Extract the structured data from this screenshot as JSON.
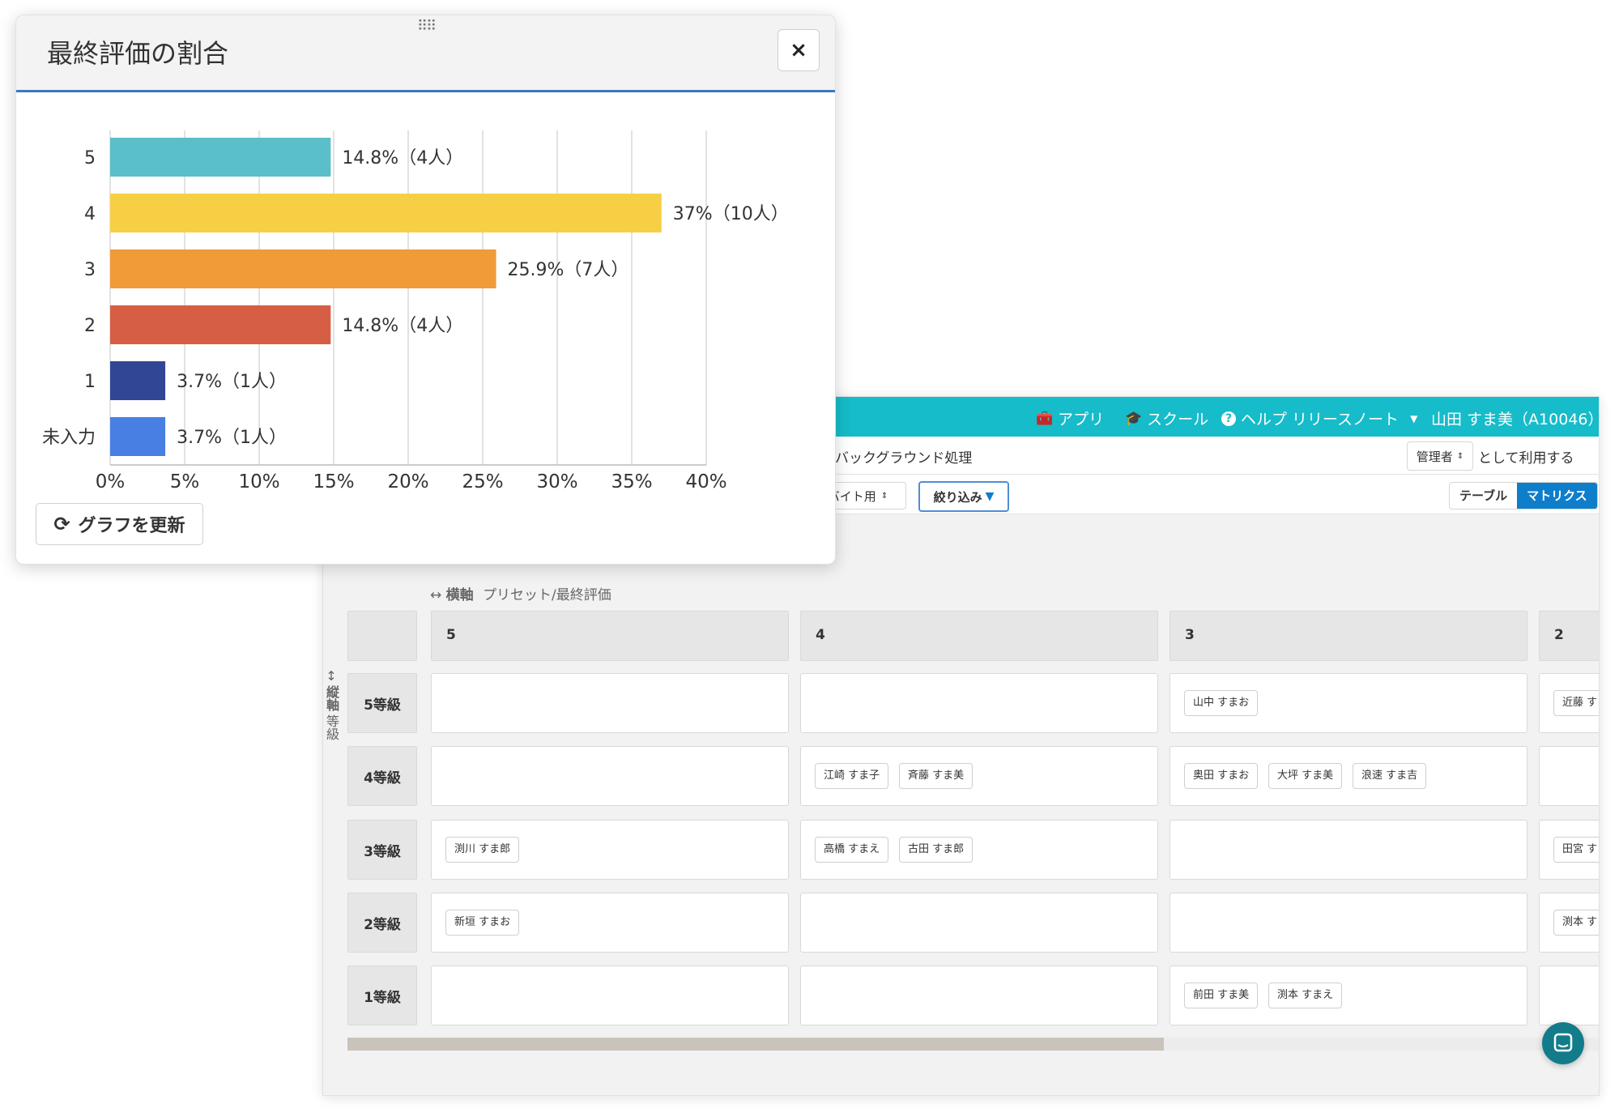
{
  "topnav": {
    "apps": "アプリ",
    "school": "スクール",
    "help": "ヘルプ",
    "release_notes": "リリースノート",
    "user": "山田 すま美（A10046）"
  },
  "subbar": {
    "background": "バックグラウンド処理",
    "role": "管理者",
    "use_as": "として利用する"
  },
  "toolbar": {
    "preset": "バイト用",
    "filter": "絞り込み",
    "view_table": "テーブル",
    "view_matrix": "マトリクス"
  },
  "matrix": {
    "h_axis_icon": "↔",
    "h_axis_title": "横軸",
    "h_axis_value": "プリセット/最終評価",
    "v_axis_icon": "↕",
    "v_axis_title": "縦軸",
    "v_axis_value": "等級",
    "columns": [
      "5",
      "4",
      "3",
      "2"
    ],
    "rows": [
      {
        "label": "5等級",
        "cells": [
          [],
          [],
          [
            "山中 すまお"
          ],
          [
            "近藤 す"
          ]
        ]
      },
      {
        "label": "4等級",
        "cells": [
          [],
          [
            "江崎 すま子",
            "斉藤 すま美"
          ],
          [
            "奥田 すまお",
            "大坪 すま美",
            "浪速 すま吉"
          ],
          []
        ]
      },
      {
        "label": "3等級",
        "cells": [
          [
            "渕川 すま郎"
          ],
          [
            "高橋 すまえ",
            "古田 すま郎"
          ],
          [],
          [
            "田宮 す"
          ]
        ]
      },
      {
        "label": "2等級",
        "cells": [
          [
            "新垣 すまお"
          ],
          [],
          [],
          [
            "渕本 す"
          ]
        ]
      },
      {
        "label": "1等級",
        "cells": [
          [],
          [],
          [
            "前田 すま美",
            "渕本 すまえ"
          ],
          []
        ]
      }
    ]
  },
  "modal": {
    "title": "最終評価の割合",
    "close": "×",
    "refresh": "グラフを更新"
  },
  "colors": {
    "topbar": "#16bcc9",
    "accent": "#3b78c4",
    "matrix_toggle": "#0e7ecb"
  },
  "chart_data": {
    "type": "bar",
    "orientation": "horizontal",
    "categories": [
      "5",
      "4",
      "3",
      "2",
      "1",
      "未入力"
    ],
    "values": [
      14.8,
      37,
      25.9,
      14.8,
      3.7,
      3.7
    ],
    "counts": [
      4,
      10,
      7,
      4,
      1,
      1
    ],
    "labels": [
      "14.8%（4人）",
      "37%（10人）",
      "25.9%（7人）",
      "14.8%（4人）",
      "3.7%（1人）",
      "3.7%（1人）"
    ],
    "colors": [
      "#5bbfc9",
      "#f7cf45",
      "#f09a38",
      "#d65e44",
      "#314695",
      "#477fe3"
    ],
    "xticks": [
      "0%",
      "5%",
      "10%",
      "15%",
      "20%",
      "25%",
      "30%",
      "35%",
      "40%"
    ],
    "xlim": [
      0,
      40
    ],
    "grid": true,
    "title": "最終評価の割合"
  }
}
